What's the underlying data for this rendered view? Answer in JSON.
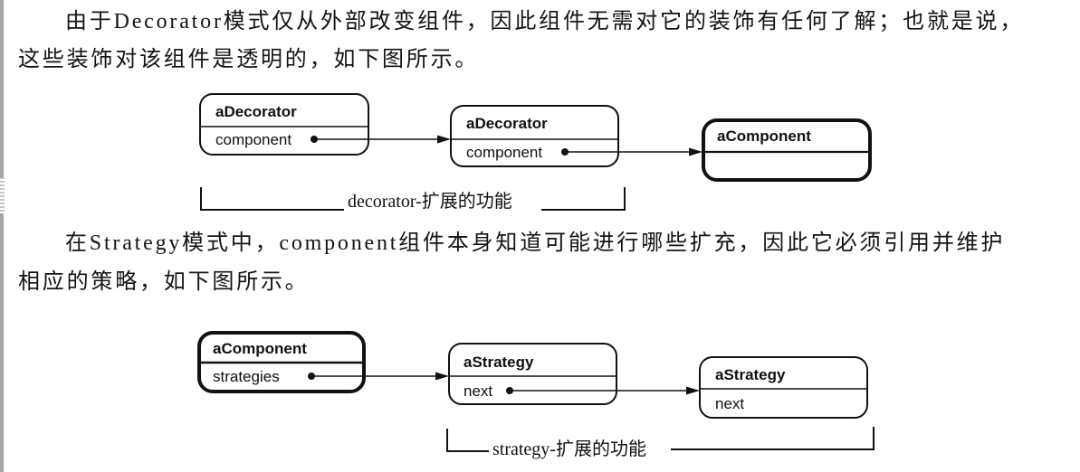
{
  "paragraphs": [
    {
      "lines": [
        "由于Decorator模式仅从外部改变组件，因此组件无需对它的装饰有任何了解；也就是说，",
        "这些装饰对该组件是透明的，如下图所示。"
      ]
    },
    {
      "lines": [
        "在Strategy模式中，component组件本身知道可能进行哪些扩充，因此它必须引用并维护",
        "相应的策略，如下图所示。"
      ]
    }
  ],
  "decorator_diagram": {
    "objects": [
      {
        "name": "aDecorator",
        "field": "component"
      },
      {
        "name": "aDecorator",
        "field": "component"
      },
      {
        "name": "aComponent"
      }
    ],
    "bracket_label": "decorator-扩展的功能"
  },
  "strategy_diagram": {
    "objects": [
      {
        "name": "aComponent",
        "field": "strategies"
      },
      {
        "name": "aStrategy",
        "field": "next"
      },
      {
        "name": "aStrategy",
        "field": "next"
      }
    ],
    "bracket_label": "strategy-扩展的功能"
  }
}
